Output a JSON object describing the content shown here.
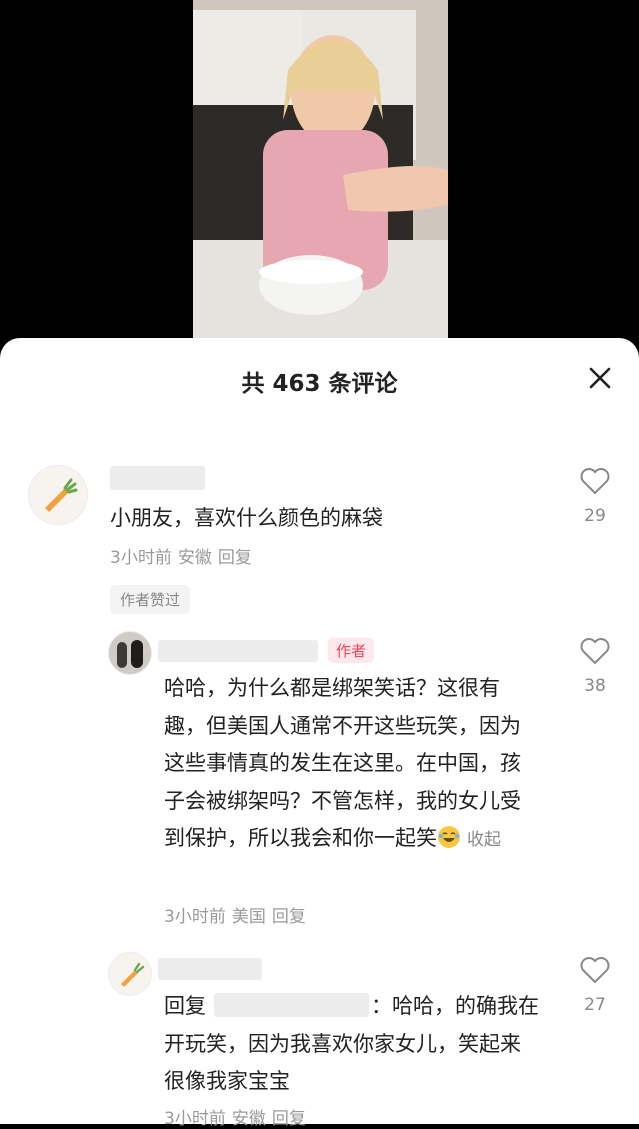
{
  "header": {
    "title": "共 463 条评论"
  },
  "comments": [
    {
      "text": "小朋友，喜欢什么颜色的麻袋",
      "time": "3小时前",
      "location": "安徽",
      "reply": "回复",
      "likes": "29",
      "badge": "作者赞过"
    },
    {
      "author_tag": "作者",
      "text": "哈哈，为什么都是绑架笑话？这很有趣，但美国人通常不开这些玩笑，因为这些事情真的发生在这里。在中国，孩子会被绑架吗？不管怎样，我的女儿受到保护，所以我会和你一起笑",
      "collapse": "收起",
      "time": "3小时前",
      "location": "美国",
      "reply": "回复",
      "likes": "38"
    },
    {
      "reply_prefix": "回复",
      "text": "：哈哈，的确我在开玩笑，因为我喜欢你家女儿，笑起来很像我家宝宝",
      "time": "3小时前",
      "location": "安徽",
      "reply": "回复",
      "likes": "27"
    }
  ],
  "icons": [
    "close-icon",
    "heart-icon",
    "carrot-avatar",
    "laugh-emoji"
  ]
}
